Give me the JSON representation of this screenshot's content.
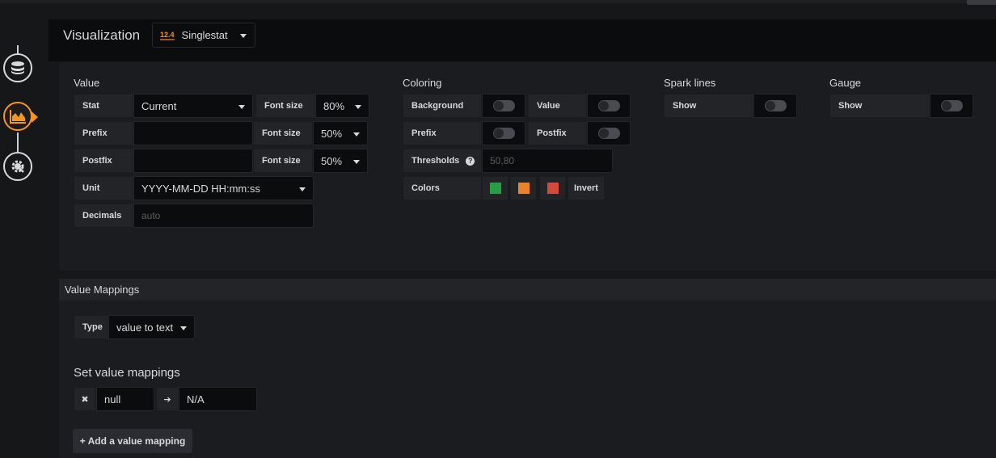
{
  "header": {
    "title": "Visualization",
    "picker": {
      "badge": "12.4",
      "name": "Singlestat"
    }
  },
  "rail": {
    "items": [
      {
        "name": "queries",
        "icon": "database-icon",
        "active": false
      },
      {
        "name": "visualization",
        "icon": "area-chart-icon",
        "active": true
      },
      {
        "name": "general",
        "icon": "gear-wrench-icon",
        "active": false
      }
    ]
  },
  "value_section": {
    "title": "Value",
    "stat": {
      "label": "Stat",
      "value": "Current"
    },
    "stat_font": {
      "label": "Font size",
      "value": "80%"
    },
    "prefix": {
      "label": "Prefix",
      "value": ""
    },
    "prefix_font": {
      "label": "Font size",
      "value": "50%"
    },
    "postfix": {
      "label": "Postfix",
      "value": ""
    },
    "postfix_font": {
      "label": "Font size",
      "value": "50%"
    },
    "unit": {
      "label": "Unit",
      "value": "YYYY-MM-DD HH:mm:ss"
    },
    "decimals": {
      "label": "Decimals",
      "placeholder": "auto"
    }
  },
  "coloring": {
    "title": "Coloring",
    "background": {
      "label": "Background",
      "on": false
    },
    "value": {
      "label": "Value",
      "on": false
    },
    "prefix": {
      "label": "Prefix",
      "on": false
    },
    "postfix": {
      "label": "Postfix",
      "on": false
    },
    "thresholds": {
      "label": "Thresholds",
      "placeholder": "50,80"
    },
    "colors": {
      "label": "Colors",
      "swatches": [
        "#299c46",
        "#ed8128",
        "#d44a3a"
      ],
      "invert_label": "Invert"
    }
  },
  "spark": {
    "title": "Spark lines",
    "show_label": "Show",
    "on": false
  },
  "gauge": {
    "title": "Gauge",
    "show_label": "Show",
    "on": false
  },
  "value_mappings": {
    "title": "Value Mappings",
    "type": {
      "label": "Type",
      "value": "value to text"
    },
    "set_title": "Set value mappings",
    "mappings": [
      {
        "from": "null",
        "to": "N/A"
      }
    ],
    "add_label": "+ Add a value mapping"
  }
}
